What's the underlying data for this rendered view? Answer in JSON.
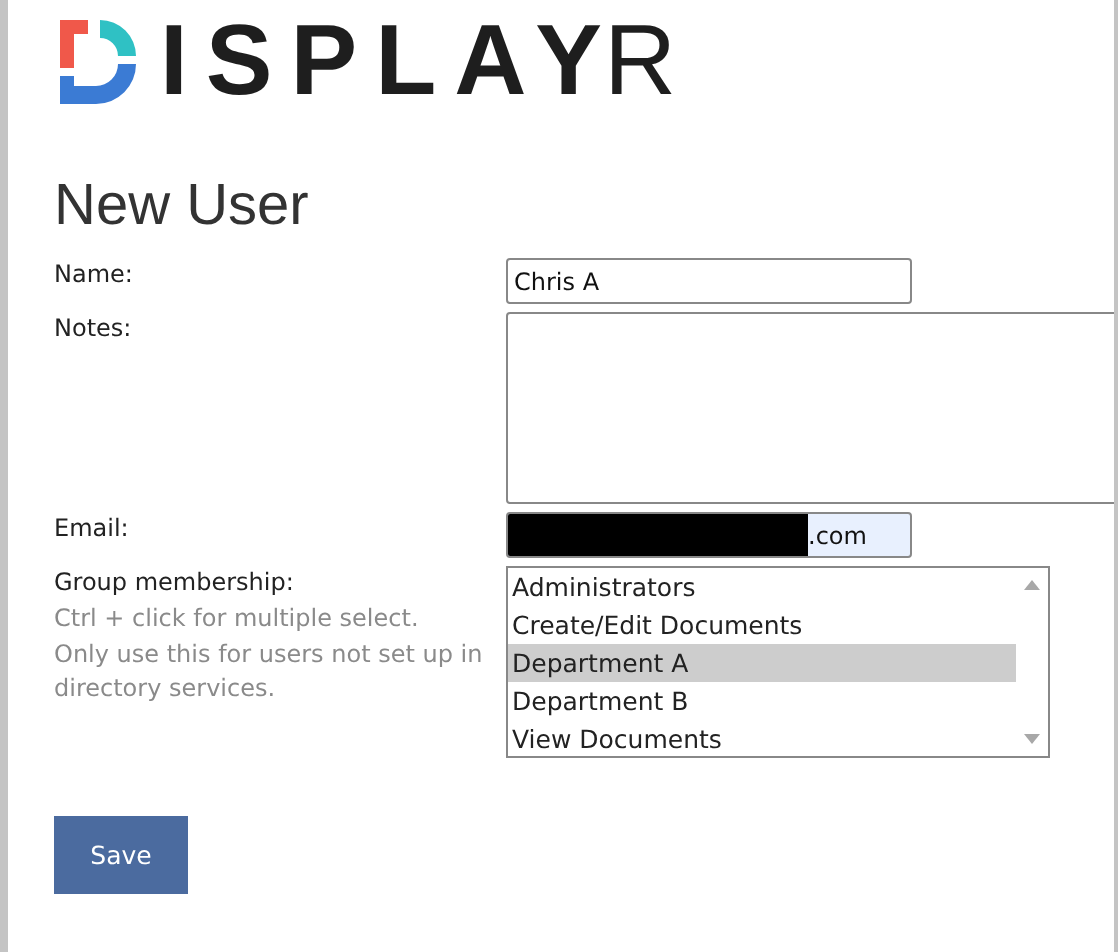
{
  "logo": {
    "bold_text": "ISPLAY",
    "light_text": "R"
  },
  "title": "New User",
  "form": {
    "name": {
      "label": "Name:",
      "value": "Chris A"
    },
    "notes": {
      "label": "Notes:"
    },
    "email": {
      "label": "Email:",
      "value": ".com",
      "redacted": true
    },
    "groups": {
      "label": "Group membership:",
      "hints": [
        "Ctrl + click for multiple select.",
        "Only use this for users not set up in directory services."
      ],
      "options": [
        {
          "label": "Administrators",
          "selected": false
        },
        {
          "label": "Create/Edit Documents",
          "selected": false
        },
        {
          "label": "Department A",
          "selected": true
        },
        {
          "label": "Department B",
          "selected": false
        },
        {
          "label": "View Documents",
          "selected": false
        }
      ]
    }
  },
  "save_button": "Save"
}
